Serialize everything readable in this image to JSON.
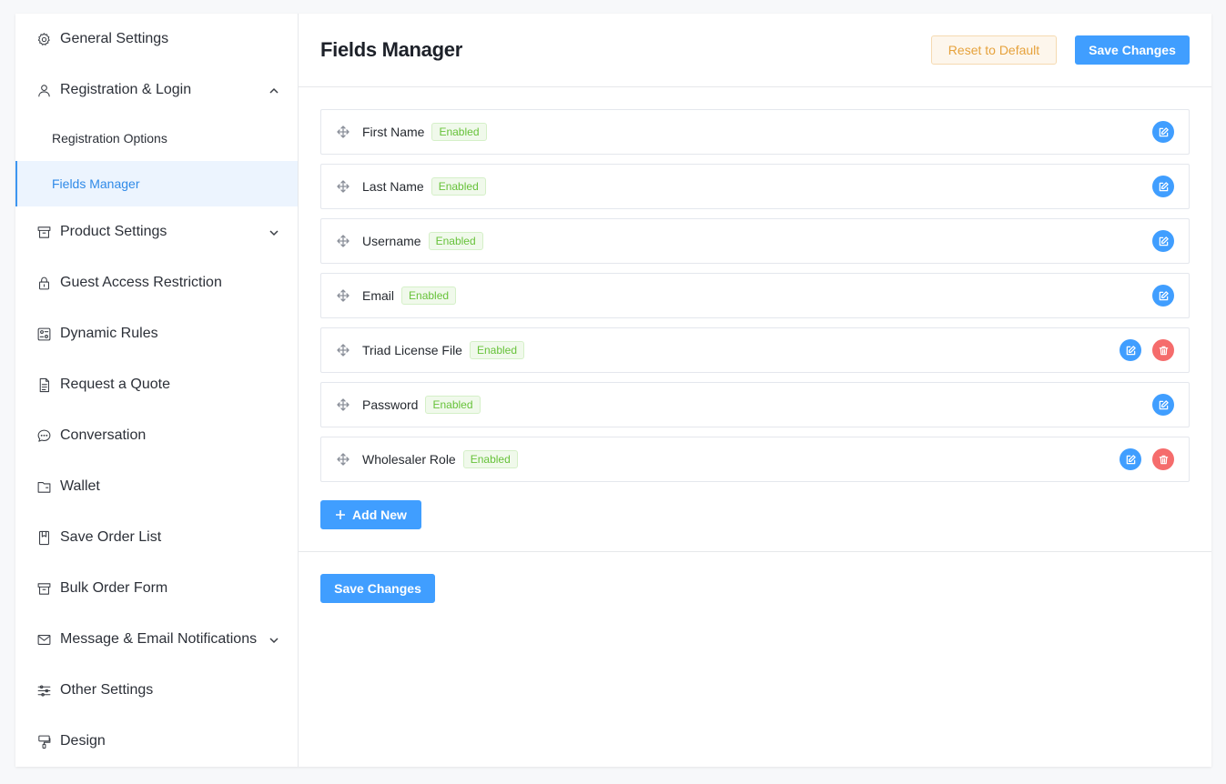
{
  "sidebar": {
    "items": [
      {
        "label": "General Settings",
        "icon": "gear-icon"
      },
      {
        "label": "Registration & Login",
        "icon": "user-icon",
        "expanded": true
      },
      {
        "label": "Product Settings",
        "icon": "archive-icon",
        "expanded": false
      },
      {
        "label": "Guest Access Restriction",
        "icon": "lock-icon"
      },
      {
        "label": "Dynamic Rules",
        "icon": "rules-icon"
      },
      {
        "label": "Request a Quote",
        "icon": "document-icon"
      },
      {
        "label": "Conversation",
        "icon": "chat-icon"
      },
      {
        "label": "Wallet",
        "icon": "wallet-icon"
      },
      {
        "label": "Save Order List",
        "icon": "bookmark-icon"
      },
      {
        "label": "Bulk Order Form",
        "icon": "box-icon"
      },
      {
        "label": "Message & Email Notifications",
        "icon": "mail-icon",
        "expanded": false
      },
      {
        "label": "Other Settings",
        "icon": "sliders-icon"
      },
      {
        "label": "Design",
        "icon": "design-icon"
      }
    ],
    "sub_items": [
      {
        "label": "Registration Options",
        "active": false
      },
      {
        "label": "Fields Manager",
        "active": true
      }
    ]
  },
  "header": {
    "title": "Fields Manager",
    "reset_label": "Reset to Default",
    "save_label": "Save Changes"
  },
  "fields": [
    {
      "name": "First Name",
      "status": "Enabled",
      "deletable": false
    },
    {
      "name": "Last Name",
      "status": "Enabled",
      "deletable": false
    },
    {
      "name": "Username",
      "status": "Enabled",
      "deletable": false
    },
    {
      "name": "Email",
      "status": "Enabled",
      "deletable": false
    },
    {
      "name": "Triad License File",
      "status": "Enabled",
      "deletable": true
    },
    {
      "name": "Password",
      "status": "Enabled",
      "deletable": false
    },
    {
      "name": "Wholesaler Role",
      "status": "Enabled",
      "deletable": true
    }
  ],
  "add_new_label": "Add New",
  "footer": {
    "save_label": "Save Changes"
  },
  "colors": {
    "primary": "#409eff",
    "danger": "#f56c6c",
    "success": "#67c23a",
    "warning": "#e6a23c",
    "active_bg": "#ecf4fe"
  }
}
